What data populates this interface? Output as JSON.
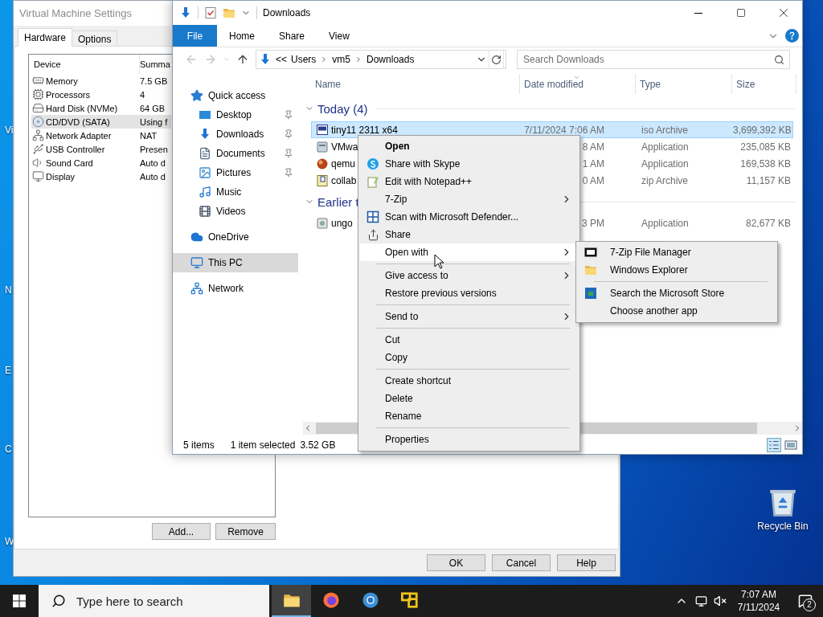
{
  "desktop": {
    "edge_labels": [
      "Vi",
      "N",
      "E",
      "C",
      "W"
    ],
    "icons": [
      {
        "label": "Recycle Bin"
      }
    ]
  },
  "vm_settings": {
    "title": "Virtual Machine Settings",
    "tabs": [
      {
        "label": "Hardware",
        "selected": true
      },
      {
        "label": "Options",
        "selected": false
      }
    ],
    "device_list": {
      "columns": [
        "Device",
        "Summa"
      ],
      "rows": [
        {
          "device": "Memory",
          "summary": "7.5 GB",
          "selected": false
        },
        {
          "device": "Processors",
          "summary": "4",
          "selected": false
        },
        {
          "device": "Hard Disk (NVMe)",
          "summary": "64 GB",
          "selected": false
        },
        {
          "device": "CD/DVD (SATA)",
          "summary": "Using f",
          "selected": true
        },
        {
          "device": "Network Adapter",
          "summary": "NAT",
          "selected": false
        },
        {
          "device": "USB Controller",
          "summary": "Presen",
          "selected": false
        },
        {
          "device": "Sound Card",
          "summary": "Auto d",
          "selected": false
        },
        {
          "device": "Display",
          "summary": "Auto d",
          "selected": false
        }
      ]
    },
    "list_buttons": [
      "Add...",
      "Remove"
    ],
    "buttons": [
      "OK",
      "Cancel",
      "Help"
    ]
  },
  "explorer": {
    "title": "Downloads",
    "ribbon_tabs": [
      {
        "label": "File",
        "kind": "file"
      },
      {
        "label": "Home",
        "kind": "tab"
      },
      {
        "label": "Share",
        "kind": "tab"
      },
      {
        "label": "View",
        "kind": "tab"
      }
    ],
    "path_overflow": "<<",
    "breadcrumb": [
      "Users",
      "vm5",
      "Downloads"
    ],
    "search": {
      "placeholder": "Search Downloads"
    },
    "nav": [
      {
        "label": "Quick access",
        "selected": false,
        "pinned": false,
        "children": [
          {
            "label": "Desktop",
            "selected": false,
            "pinned": true
          },
          {
            "label": "Downloads",
            "selected": false,
            "pinned": true
          },
          {
            "label": "Documents",
            "selected": false,
            "pinned": true
          },
          {
            "label": "Pictures",
            "selected": false,
            "pinned": true
          },
          {
            "label": "Music",
            "selected": false,
            "pinned": false
          },
          {
            "label": "Videos",
            "selected": false,
            "pinned": false
          }
        ]
      },
      {
        "label": "OneDrive",
        "selected": false,
        "pinned": false
      },
      {
        "label": "This PC",
        "selected": true,
        "pinned": false
      },
      {
        "label": "Network",
        "selected": false,
        "pinned": false
      }
    ],
    "columns": [
      "Name",
      "Date modified",
      "Type",
      "Size"
    ],
    "groups": [
      {
        "label": "Today (4)",
        "expanded": true,
        "rows": [
          {
            "name": "tiny11 2311 x64",
            "date": "7/11/2024 7:06 AM",
            "type": "iso Archive",
            "size": "3,699,392 KB",
            "selected": true
          },
          {
            "name": "VMwa",
            "date": "8 AM",
            "type": "Application",
            "size": "235,085 KB",
            "selected": false
          },
          {
            "name": "qemu",
            "date": "1 AM",
            "type": "Application",
            "size": "169,538 KB",
            "selected": false
          },
          {
            "name": "collab",
            "date": "0 AM",
            "type": "zip Archive",
            "size": "11,157 KB",
            "selected": false
          }
        ]
      },
      {
        "label": "Earlier t",
        "expanded": true,
        "rows": [
          {
            "name": "ungo",
            "date": "3 PM",
            "type": "Application",
            "size": "82,677 KB",
            "selected": false
          }
        ]
      }
    ],
    "status": {
      "count": "5 items",
      "selection": "1 item selected",
      "size": "3.52 GB"
    }
  },
  "context_menu": {
    "items": [
      {
        "kind": "item",
        "label": "Open",
        "default": true,
        "submenu": false,
        "highlighted": false
      },
      {
        "kind": "item",
        "label": "Share with Skype",
        "default": false,
        "submenu": false,
        "highlighted": false
      },
      {
        "kind": "item",
        "label": "Edit with Notepad++",
        "default": false,
        "submenu": false,
        "highlighted": false
      },
      {
        "kind": "item",
        "label": "7-Zip",
        "default": false,
        "submenu": true,
        "highlighted": false
      },
      {
        "kind": "item",
        "label": "Scan with Microsoft Defender...",
        "default": false,
        "submenu": false,
        "highlighted": false
      },
      {
        "kind": "item",
        "label": "Share",
        "default": false,
        "submenu": false,
        "highlighted": false
      },
      {
        "kind": "item",
        "label": "Open with",
        "default": false,
        "submenu": true,
        "highlighted": true
      },
      {
        "kind": "separator"
      },
      {
        "kind": "item",
        "label": "Give access to",
        "default": false,
        "submenu": true,
        "highlighted": false
      },
      {
        "kind": "item",
        "label": "Restore previous versions",
        "default": false,
        "submenu": false,
        "highlighted": false
      },
      {
        "kind": "separator"
      },
      {
        "kind": "item",
        "label": "Send to",
        "default": false,
        "submenu": true,
        "highlighted": false
      },
      {
        "kind": "separator"
      },
      {
        "kind": "item",
        "label": "Cut",
        "default": false,
        "submenu": false,
        "highlighted": false
      },
      {
        "kind": "item",
        "label": "Copy",
        "default": false,
        "submenu": false,
        "highlighted": false
      },
      {
        "kind": "separator"
      },
      {
        "kind": "item",
        "label": "Create shortcut",
        "default": false,
        "submenu": false,
        "highlighted": false
      },
      {
        "kind": "item",
        "label": "Delete",
        "default": false,
        "submenu": false,
        "highlighted": false
      },
      {
        "kind": "item",
        "label": "Rename",
        "default": false,
        "submenu": false,
        "highlighted": false
      },
      {
        "kind": "separator"
      },
      {
        "kind": "item",
        "label": "Properties",
        "default": false,
        "submenu": false,
        "highlighted": false
      }
    ]
  },
  "submenu": {
    "items": [
      {
        "kind": "item",
        "label": "7-Zip File Manager"
      },
      {
        "kind": "item",
        "label": "Windows Explorer"
      },
      {
        "kind": "separator"
      },
      {
        "kind": "item",
        "label": "Search the Microsoft Store"
      },
      {
        "kind": "item",
        "label": "Choose another app"
      }
    ]
  },
  "taskbar": {
    "search": {
      "placeholder": "Type here to search"
    },
    "apps": [
      {
        "active": true
      },
      {
        "active": false
      },
      {
        "active": false
      },
      {
        "active": false
      }
    ],
    "time": "7:07 AM",
    "date": "7/11/2024",
    "notifications": "2"
  }
}
